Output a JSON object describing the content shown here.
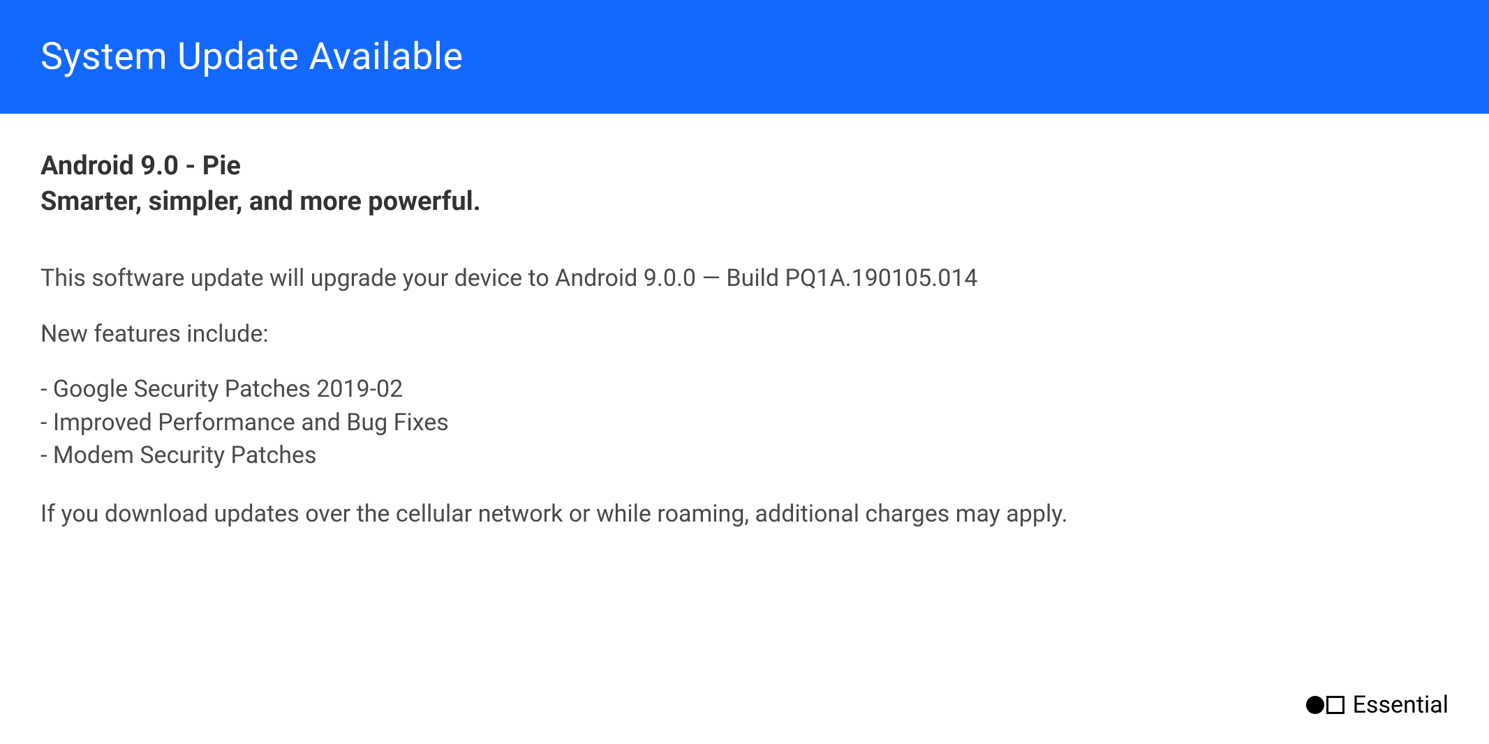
{
  "header": {
    "title": "System Update Available"
  },
  "subtitle": {
    "line1": "Android 9.0 - Pie",
    "line2": "Smarter, simpler, and more powerful."
  },
  "description": "This software update will upgrade your device to Android 9.0.0 — Build PQ1A.190105.014",
  "features": {
    "label": "New features include:",
    "items": [
      "Google Security Patches 2019-02",
      "Improved Performance and Bug Fixes",
      "Modem Security Patches"
    ]
  },
  "disclaimer": "If you download updates over the cellular network or while roaming, additional charges may apply.",
  "brand": {
    "name": "Essential"
  }
}
